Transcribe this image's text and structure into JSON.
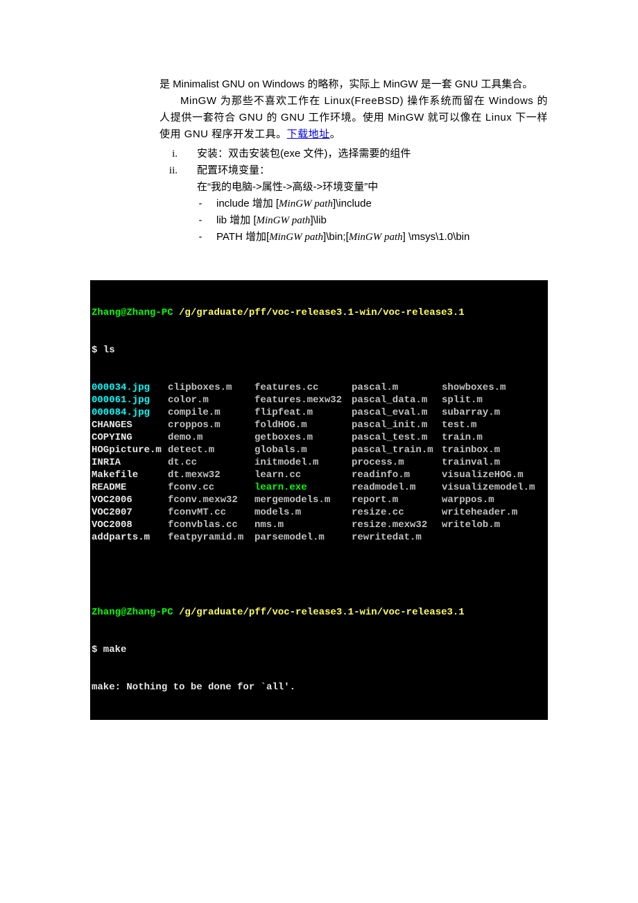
{
  "doc": {
    "p1": "是 Minimalist GNU on Windows 的略称，实际上 MinGW 是一套 GNU 工具集合。",
    "p2_a": "MinGW 为那些不喜欢工作在 Linux(FreeBSD) 操作系统而留在 Windows 的人提供一套符合 GNU 的 GNU 工作环境。使用 MinGW 就可以像在 Linux 下一样使用 GNU 程序开发工具。",
    "p2_link": "下载地址",
    "p2_end": "。",
    "list_i_marker": "i.",
    "list_i_text": "安装：双击安装包(exe 文件)，选择需要的组件",
    "list_ii_marker": "ii.",
    "list_ii_text": "配置环境变量：",
    "list_ii_sub0": "在“我的电脑->属性->高级->环境变量”中",
    "list_ii_sub1_a": "include 增加 [",
    "list_ii_sub1_italic": "MinGW path",
    "list_ii_sub1_b": "]\\include",
    "list_ii_sub2_a": "lib 增加 [",
    "list_ii_sub2_italic": "MinGW path",
    "list_ii_sub2_b": "]\\lib",
    "list_ii_sub3_a": "PATH 增加[",
    "list_ii_sub3_i1": "MinGW path",
    "list_ii_sub3_b": "]\\bin;[",
    "list_ii_sub3_i2": "MinGW path",
    "list_ii_sub3_c": "] \\msys\\1.0\\bin"
  },
  "term": {
    "prompt_user": "Zhang@Zhang-PC ",
    "prompt_path": "/g/graduate/pff/voc-release3.1-win/voc-release3.1",
    "cmd1": "$ ls",
    "cmd2": "$ make",
    "make_out": "make: Nothing to be done for `all'.",
    "ls": {
      "rows": [
        {
          "c0": {
            "t": "000034.jpg",
            "k": "cyan"
          },
          "c1": {
            "t": "clipboxes.m",
            "k": "grey"
          },
          "c2": {
            "t": "features.cc",
            "k": "grey"
          },
          "c3": {
            "t": "pascal.m",
            "k": "grey"
          },
          "c4": {
            "t": "showboxes.m",
            "k": "grey"
          }
        },
        {
          "c0": {
            "t": "000061.jpg",
            "k": "cyan"
          },
          "c1": {
            "t": "color.m",
            "k": "grey"
          },
          "c2": {
            "t": "features.mexw32",
            "k": "grey"
          },
          "c3": {
            "t": "pascal_data.m",
            "k": "grey"
          },
          "c4": {
            "t": "split.m",
            "k": "grey"
          }
        },
        {
          "c0": {
            "t": "000084.jpg",
            "k": "cyan"
          },
          "c1": {
            "t": "compile.m",
            "k": "grey"
          },
          "c2": {
            "t": "flipfeat.m",
            "k": "grey"
          },
          "c3": {
            "t": "pascal_eval.m",
            "k": "grey"
          },
          "c4": {
            "t": "subarray.m",
            "k": "grey"
          }
        },
        {
          "c0": {
            "t": "CHANGES",
            "k": "white"
          },
          "c1": {
            "t": "croppos.m",
            "k": "grey"
          },
          "c2": {
            "t": "foldHOG.m",
            "k": "grey"
          },
          "c3": {
            "t": "pascal_init.m",
            "k": "grey"
          },
          "c4": {
            "t": "test.m",
            "k": "grey"
          }
        },
        {
          "c0": {
            "t": "COPYING",
            "k": "white"
          },
          "c1": {
            "t": "demo.m",
            "k": "grey"
          },
          "c2": {
            "t": "getboxes.m",
            "k": "grey"
          },
          "c3": {
            "t": "pascal_test.m",
            "k": "grey"
          },
          "c4": {
            "t": "train.m",
            "k": "grey"
          }
        },
        {
          "c0": {
            "t": "HOGpicture.m",
            "k": "white"
          },
          "c1": {
            "t": "detect.m",
            "k": "grey"
          },
          "c2": {
            "t": "globals.m",
            "k": "grey"
          },
          "c3": {
            "t": "pascal_train.m",
            "k": "grey"
          },
          "c4": {
            "t": "trainbox.m",
            "k": "grey"
          }
        },
        {
          "c0": {
            "t": "INRIA",
            "k": "white"
          },
          "c1": {
            "t": "dt.cc",
            "k": "grey"
          },
          "c2": {
            "t": "initmodel.m",
            "k": "grey"
          },
          "c3": {
            "t": "process.m",
            "k": "grey"
          },
          "c4": {
            "t": "trainval.m",
            "k": "grey"
          }
        },
        {
          "c0": {
            "t": "Makefile",
            "k": "white"
          },
          "c1": {
            "t": "dt.mexw32",
            "k": "grey"
          },
          "c2": {
            "t": "learn.cc",
            "k": "grey"
          },
          "c3": {
            "t": "readinfo.m",
            "k": "grey"
          },
          "c4": {
            "t": "visualizeHOG.m",
            "k": "grey"
          }
        },
        {
          "c0": {
            "t": "README",
            "k": "white"
          },
          "c1": {
            "t": "fconv.cc",
            "k": "grey"
          },
          "c2": {
            "t": "learn.exe",
            "k": "green"
          },
          "c3": {
            "t": "readmodel.m",
            "k": "grey"
          },
          "c4": {
            "t": "visualizemodel.m",
            "k": "grey"
          }
        },
        {
          "c0": {
            "t": "VOC2006",
            "k": "white"
          },
          "c1": {
            "t": "fconv.mexw32",
            "k": "grey"
          },
          "c2": {
            "t": "mergemodels.m",
            "k": "grey"
          },
          "c3": {
            "t": "report.m",
            "k": "grey"
          },
          "c4": {
            "t": "warppos.m",
            "k": "grey"
          }
        },
        {
          "c0": {
            "t": "VOC2007",
            "k": "white"
          },
          "c1": {
            "t": "fconvMT.cc",
            "k": "grey"
          },
          "c2": {
            "t": "models.m",
            "k": "grey"
          },
          "c3": {
            "t": "resize.cc",
            "k": "grey"
          },
          "c4": {
            "t": "writeheader.m",
            "k": "grey"
          }
        },
        {
          "c0": {
            "t": "VOC2008",
            "k": "white"
          },
          "c1": {
            "t": "fconvblas.cc",
            "k": "grey"
          },
          "c2": {
            "t": "nms.m",
            "k": "grey"
          },
          "c3": {
            "t": "resize.mexw32",
            "k": "grey"
          },
          "c4": {
            "t": "writelob.m",
            "k": "grey"
          }
        },
        {
          "c0": {
            "t": "addparts.m",
            "k": "white"
          },
          "c1": {
            "t": "featpyramid.m",
            "k": "grey"
          },
          "c2": {
            "t": "parsemodel.m",
            "k": "grey"
          },
          "c3": {
            "t": "rewritedat.m",
            "k": "grey"
          },
          "c4": {
            "t": "",
            "k": "grey"
          }
        }
      ]
    }
  }
}
